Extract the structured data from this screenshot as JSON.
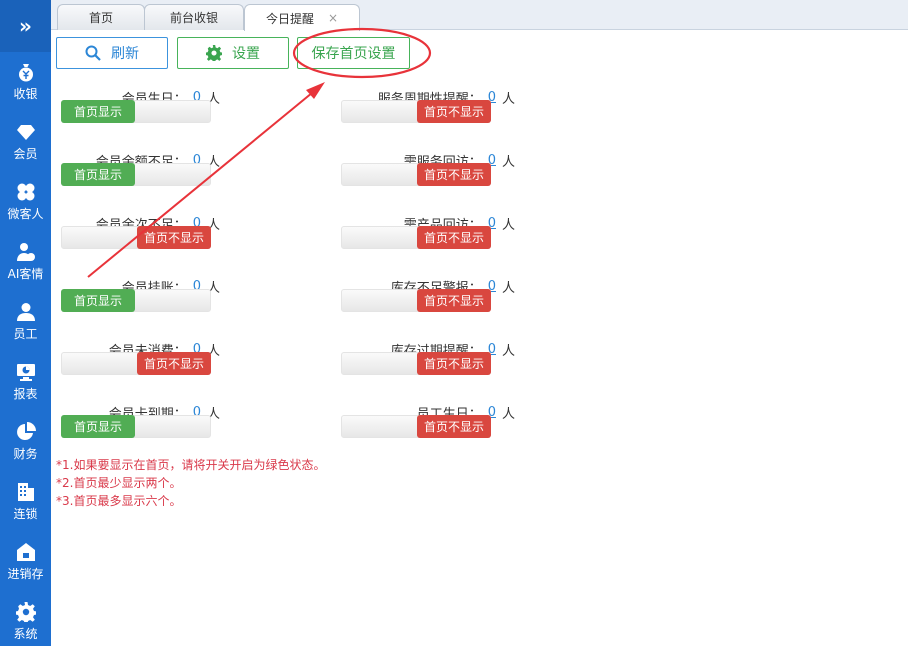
{
  "sidebar": {
    "toggle_icon": "»",
    "items": [
      {
        "label": "收银",
        "icon": "yen-bag-icon"
      },
      {
        "label": "会员",
        "icon": "diamond-icon"
      },
      {
        "label": "微客人",
        "icon": "clover-icon"
      },
      {
        "label": "AI客情",
        "icon": "ai-user-icon"
      },
      {
        "label": "员工",
        "icon": "person-icon"
      },
      {
        "label": "报表",
        "icon": "monitor-chart-icon"
      },
      {
        "label": "财务",
        "icon": "pie-chart-icon"
      },
      {
        "label": "连锁",
        "icon": "building-icon"
      },
      {
        "label": "进销存",
        "icon": "warehouse-icon"
      },
      {
        "label": "系统",
        "icon": "gear-icon"
      }
    ]
  },
  "tabs": [
    {
      "label": "首页"
    },
    {
      "label": "前台收银"
    },
    {
      "label": "今日提醒",
      "active": true,
      "close": "×"
    }
  ],
  "toolbar": {
    "refresh_label": "刷新",
    "settings_label": "设置",
    "save_label": "保存首页设置"
  },
  "toggle_on_text": "首页显示",
  "toggle_off_text": "首页不显示",
  "unit": "人",
  "reminders": [
    {
      "title": "会员生日：",
      "count": "0",
      "show_on_home": true
    },
    {
      "title": "服务周期性提醒：",
      "count": "0",
      "show_on_home": false
    },
    {
      "title": "会员余额不足：",
      "count": "0",
      "show_on_home": true
    },
    {
      "title": "需服务回访：",
      "count": "0",
      "show_on_home": false
    },
    {
      "title": "会员余次不足：",
      "count": "0",
      "show_on_home": false
    },
    {
      "title": "需产品回访：",
      "count": "0",
      "show_on_home": false
    },
    {
      "title": "会员挂账：",
      "count": "0",
      "show_on_home": true
    },
    {
      "title": "库存不足警报：",
      "count": "0",
      "show_on_home": false
    },
    {
      "title": "会员未消费：",
      "count": "0",
      "show_on_home": false
    },
    {
      "title": "库存过期提醒：",
      "count": "0",
      "show_on_home": false
    },
    {
      "title": "会员卡到期：",
      "count": "0",
      "show_on_home": true
    },
    {
      "title": "员工生日：",
      "count": "0",
      "show_on_home": false
    }
  ],
  "notes": [
    "*1.如果要显示在首页，请将开关开启为绿色状态。",
    "*2.首页最少显示两个。",
    "*3.首页最多显示六个。"
  ],
  "colors": {
    "sidebar": "#1e6fd0",
    "toggle_on": "#51ad54",
    "toggle_off": "#d9473f",
    "annotation": "#e8333a",
    "note_text": "#d9394a"
  }
}
